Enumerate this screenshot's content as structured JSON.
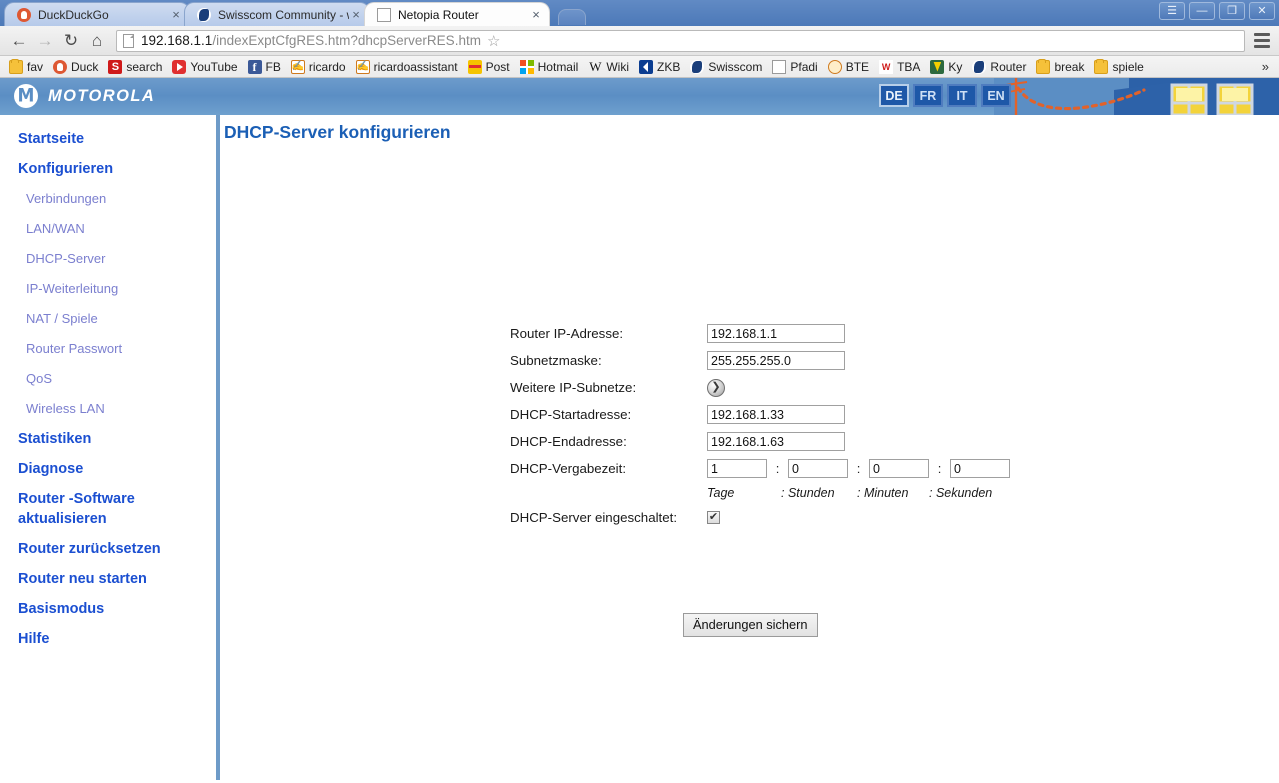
{
  "browser": {
    "tabs": [
      {
        "title": "DuckDuckGo",
        "favicon": "duckduckgo-icon",
        "close": "×",
        "active": false
      },
      {
        "title": "Swisscom Community - w",
        "favicon": "swisscom-icon",
        "close": "×",
        "active": false
      },
      {
        "title": "Netopia Router",
        "favicon": "page-icon",
        "close": "×",
        "active": true
      }
    ],
    "window_controls": [
      {
        "name": "account-button",
        "glyph": "☰"
      },
      {
        "name": "minimize-button",
        "glyph": "—"
      },
      {
        "name": "restore-button",
        "glyph": "❐"
      },
      {
        "name": "close-button",
        "glyph": "✕"
      }
    ],
    "nav": {
      "back": "←",
      "forward": "→",
      "reload": "↻",
      "home": "⌂",
      "star": "☆",
      "url_host": "192.168.1.1",
      "url_path": "/indexExptCfgRES.htm?dhcpServerRES.htm",
      "url_full": "192.168.1.1/indexExptCfgRES.htm?dhcpServerRES.htm"
    },
    "bookmarks": [
      {
        "label": "fav",
        "icon": "folder-icon"
      },
      {
        "label": "Duck",
        "icon": "duckduckgo-icon"
      },
      {
        "label": "search",
        "icon": "s-icon"
      },
      {
        "label": "YouTube",
        "icon": "youtube-icon"
      },
      {
        "label": "FB",
        "icon": "facebook-icon"
      },
      {
        "label": "ricardo",
        "icon": "hand-icon"
      },
      {
        "label": "ricardoassistant",
        "icon": "hand-icon"
      },
      {
        "label": "Post",
        "icon": "post-icon"
      },
      {
        "label": "Hotmail",
        "icon": "hotmail-icon"
      },
      {
        "label": "Wiki",
        "icon": "wikipedia-icon"
      },
      {
        "label": "ZKB",
        "icon": "zkb-icon"
      },
      {
        "label": "Swisscom",
        "icon": "swisscom-icon"
      },
      {
        "label": "Pfadi",
        "icon": "page-icon"
      },
      {
        "label": "BTE",
        "icon": "bte-icon"
      },
      {
        "label": "TBA",
        "icon": "tba-icon"
      },
      {
        "label": "Ky",
        "icon": "ky-icon"
      },
      {
        "label": "Router",
        "icon": "swisscom-icon"
      },
      {
        "label": "break",
        "icon": "folder-icon"
      },
      {
        "label": "spiele",
        "icon": "folder-icon"
      }
    ],
    "bookmarks_overflow": "»"
  },
  "router": {
    "brand": "MOTOROLA",
    "languages": [
      {
        "code": "DE",
        "active": true
      },
      {
        "code": "FR",
        "active": false
      },
      {
        "code": "IT",
        "active": false
      },
      {
        "code": "EN",
        "active": false
      }
    ],
    "page_title": "DHCP-Server konfigurieren",
    "sidebar": [
      {
        "label": "Startseite",
        "level": "top"
      },
      {
        "label": "Konfigurieren",
        "level": "top"
      },
      {
        "label": "Verbindungen",
        "level": "sub"
      },
      {
        "label": "LAN/WAN",
        "level": "sub"
      },
      {
        "label": "DHCP-Server",
        "level": "sub"
      },
      {
        "label": "IP-Weiterleitung",
        "level": "sub"
      },
      {
        "label": "NAT / Spiele",
        "level": "sub"
      },
      {
        "label": "Router Passwort",
        "level": "sub"
      },
      {
        "label": "QoS",
        "level": "sub"
      },
      {
        "label": "Wireless LAN",
        "level": "sub"
      },
      {
        "label": "Statistiken",
        "level": "top"
      },
      {
        "label": "Diagnose",
        "level": "top"
      },
      {
        "label": "Router -Software aktualisieren",
        "level": "top2"
      },
      {
        "label": "Router zurücksetzen",
        "level": "top"
      },
      {
        "label": "Router neu starten",
        "level": "top"
      },
      {
        "label": "Basismodus",
        "level": "top"
      },
      {
        "label": "Hilfe",
        "level": "top"
      }
    ],
    "form": {
      "router_ip_label": "Router IP-Adresse:",
      "router_ip_value": "192.168.1.1",
      "subnet_label": "Subnetzmaske:",
      "subnet_value": "255.255.255.0",
      "more_subnets_label": "Weitere IP-Subnetze:",
      "more_subnets_arrow": "❯",
      "dhcp_start_label": "DHCP-Startadresse:",
      "dhcp_start_value": "192.168.1.33",
      "dhcp_end_label": "DHCP-Endadresse:",
      "dhcp_end_value": "192.168.1.63",
      "lease_label": "DHCP-Vergabezeit:",
      "lease_days": "1",
      "lease_hours": "0",
      "lease_minutes": "0",
      "lease_seconds": "0",
      "sep": ":",
      "unit_days": "Tage",
      "unit_hours": ": Stunden",
      "unit_minutes": ": Minuten",
      "unit_seconds": ": Sekunden",
      "enabled_label": "DHCP-Server eingeschaltet:",
      "enabled_checked": "✔",
      "save_label": "Änderungen sichern"
    }
  },
  "colors": {
    "header_blue": "#5b8ec4",
    "link_blue": "#1b4fd1",
    "title_blue": "#1b5fb5",
    "sub_link": "#7b7fcf",
    "rule_blue": "#6e9bc8"
  }
}
